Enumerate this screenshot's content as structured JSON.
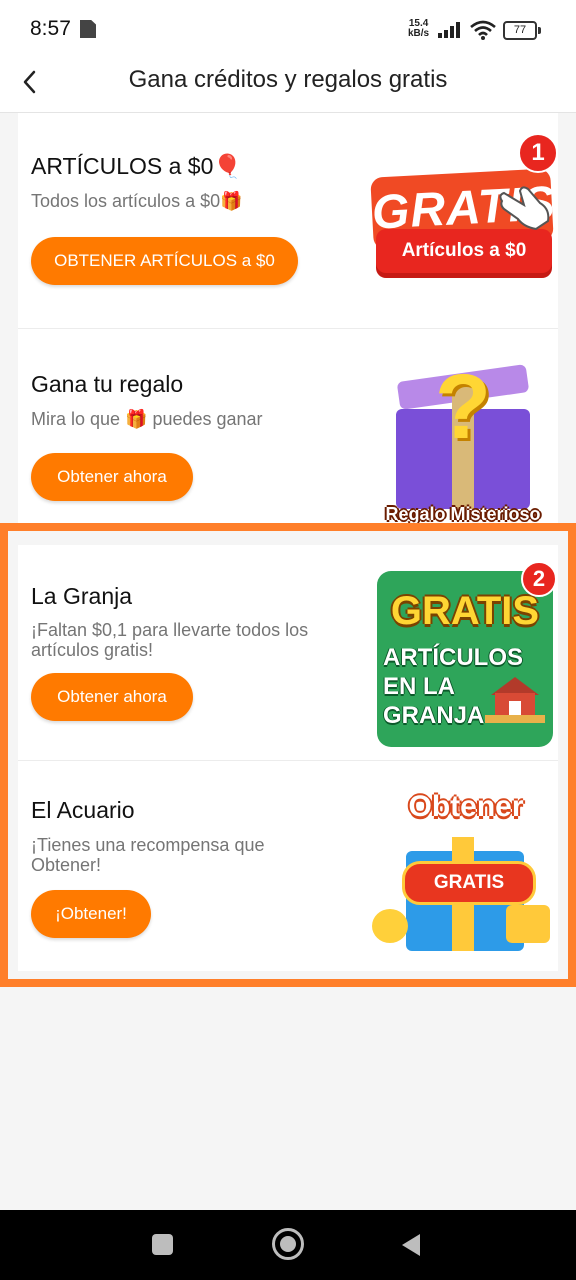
{
  "status_bar": {
    "time": "8:57",
    "net_speed_value": "15.4",
    "net_speed_unit": "kB/s",
    "battery": "77"
  },
  "header": {
    "title": "Gana créditos y regalos gratis"
  },
  "cards": [
    {
      "name": "ARTÍCULOS a $0🎈",
      "desc": "Todos los artículos a $0🎁",
      "button": "OBTENER ARTÍCULOS a $0",
      "badge": "1",
      "img_text_1": "GRATIS",
      "img_text_2": "Artículos a $0"
    },
    {
      "name": "Gana tu regalo",
      "desc": "Mira lo que 🎁 puedes ganar",
      "button": "Obtener ahora",
      "img_text_1": "?",
      "img_text_2": "Regalo Misterioso"
    },
    {
      "name": "La Granja",
      "desc": "¡Faltan $0,1 para llevarte todos los artículos gratis!",
      "button": "Obtener ahora",
      "badge": "2",
      "img_text_1": "GRATIS",
      "img_text_2": "ARTÍCULOS",
      "img_text_3": "EN LA",
      "img_text_4": "GRANJA"
    },
    {
      "name": "El Acuario",
      "desc": "¡Tienes una recompensa que Obtener!",
      "button": "¡Obtener!",
      "img_text_1": "Obtener",
      "img_text_2": "GRATIS"
    }
  ],
  "colors": {
    "accent": "#ff7a00",
    "highlight_frame": "#ff7f2a",
    "badge_red": "#e8261f",
    "farm_green": "#2ea55a"
  }
}
